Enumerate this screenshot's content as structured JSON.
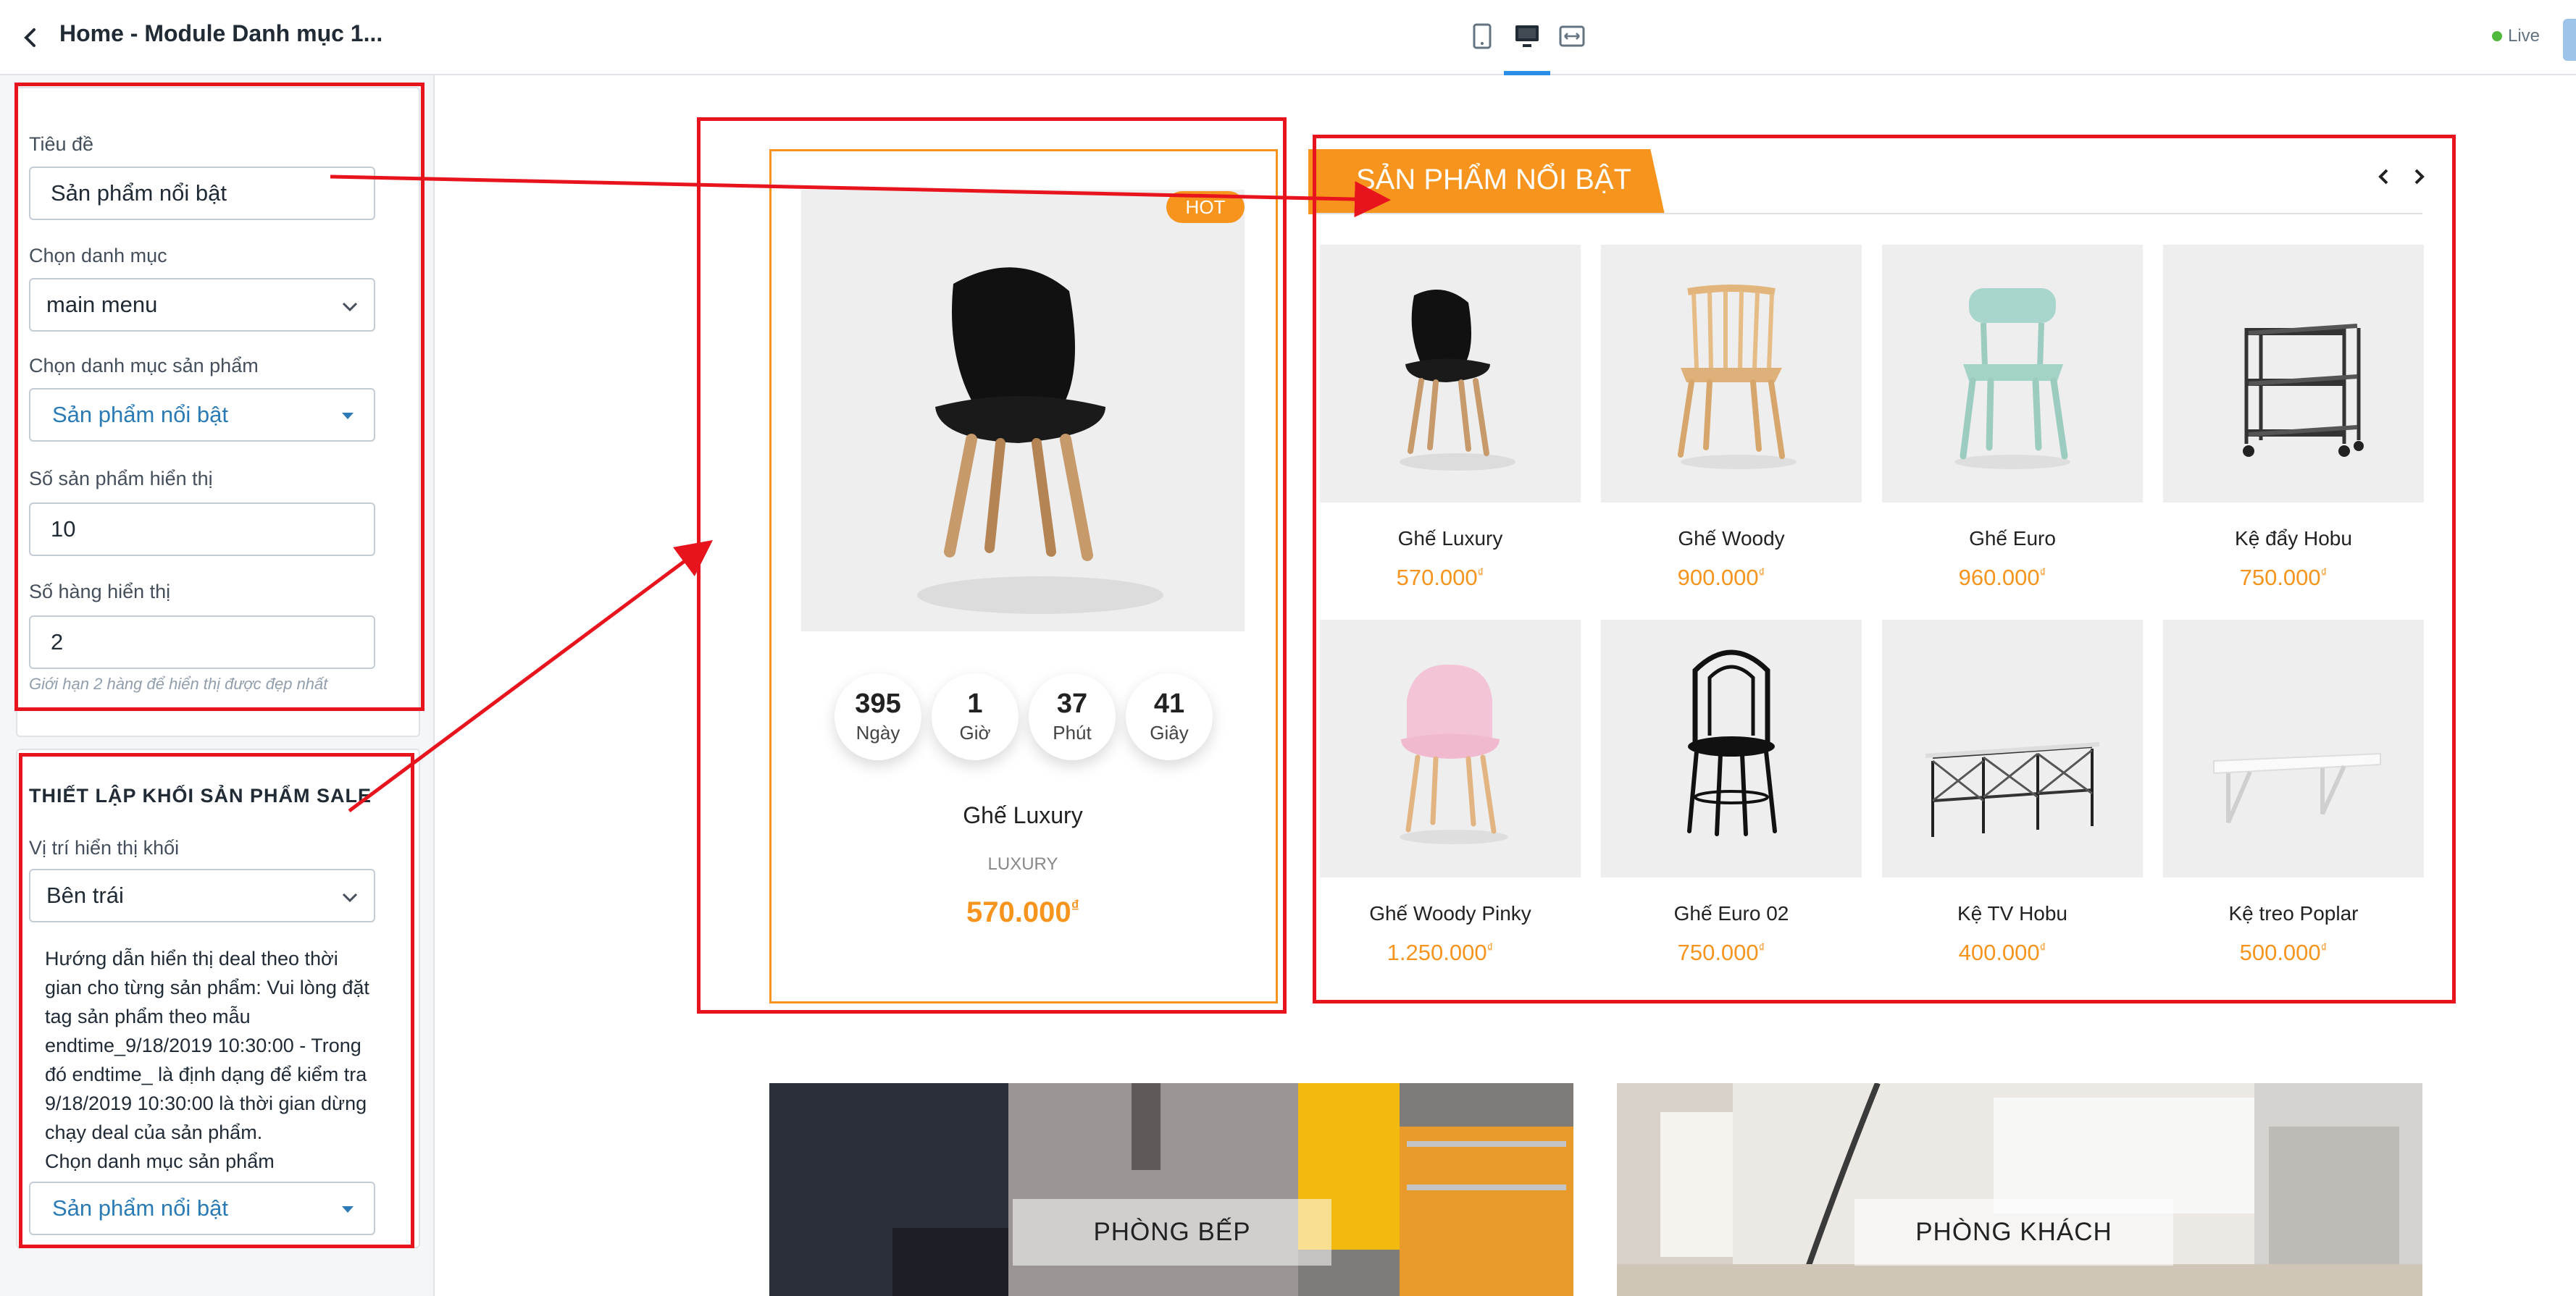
{
  "sidebar": {
    "title": "Home - Module Danh mục 1...",
    "fields": {
      "title_label": "Tiêu đề",
      "title_value": "Sản phẩm nổi bật",
      "menu_label": "Chọn danh mục",
      "menu_value": "main menu",
      "product_cat_label": "Chọn danh mục sản phẩm",
      "product_cat_value": "Sản phẩm nổi bật",
      "count_label": "Số sản phẩm hiển thị",
      "count_value": "10",
      "rows_label": "Số hàng hiển thị",
      "rows_value": "2",
      "rows_hint": "Giới hạn 2 hàng để hiển thị được đẹp nhất"
    },
    "sale": {
      "heading": "THIẾT LẬP KHỐI SẢN PHẨM SALE",
      "position_label": "Vị trí hiển thị khối",
      "position_value": "Bên trái",
      "guide_lines": [
        "Hướng dẫn hiển thị deal theo thời",
        "gian cho từng sản phẩm: Vui lòng đặt",
        "tag sản phẩm theo mẫu",
        "endtime_9/18/2019 10:30:00 - Trong",
        "đó endtime_ là định dạng để kiểm tra",
        "9/18/2019 10:30:00 là thời gian dừng",
        "chạy deal của sản phẩm."
      ],
      "product_cat_label": "Chọn danh mục sản phẩm",
      "product_cat_value": "Sản phẩm nổi bật"
    }
  },
  "topbar": {
    "device_icons": [
      "mobile-icon",
      "desktop-icon",
      "fullwidth-icon"
    ],
    "active_device": "desktop",
    "live_label": "Live"
  },
  "preview": {
    "deal": {
      "badge": "HOT",
      "countdown": [
        {
          "num": "395",
          "label": "Ngày"
        },
        {
          "num": "1",
          "label": "Giờ"
        },
        {
          "num": "37",
          "label": "Phút"
        },
        {
          "num": "41",
          "label": "Giây"
        }
      ],
      "name": "Ghế Luxury",
      "category": "LUXURY",
      "price": "570.000",
      "currency": "₫"
    },
    "section_title": "SẢN PHẨM NỔI BẬT",
    "products": [
      {
        "name": "Ghế Luxury",
        "price": "570.000",
        "icon": "black-chair"
      },
      {
        "name": "Ghế Woody",
        "price": "900.000",
        "icon": "wood-chair"
      },
      {
        "name": "Ghế Euro",
        "price": "960.000",
        "icon": "mint-chair"
      },
      {
        "name": "Kệ đẩy Hobu",
        "price": "750.000",
        "icon": "trolley-shelf"
      },
      {
        "name": "Ghế Woody Pinky",
        "price": "1.250.000",
        "icon": "pink-chair"
      },
      {
        "name": "Ghế Euro 02",
        "price": "750.000",
        "icon": "bistro-chair"
      },
      {
        "name": "Kệ TV Hobu",
        "price": "400.000",
        "icon": "tv-shelf"
      },
      {
        "name": "Kệ treo Poplar",
        "price": "500.000",
        "icon": "wall-shelf"
      }
    ],
    "currency": "₫",
    "banners": [
      {
        "label": "PHÒNG BẾP"
      },
      {
        "label": "PHÒNG KHÁCH"
      }
    ]
  },
  "colors": {
    "accent": "#f7941d",
    "annotation": "#e8141d",
    "link_blue": "#2a7ab5"
  }
}
